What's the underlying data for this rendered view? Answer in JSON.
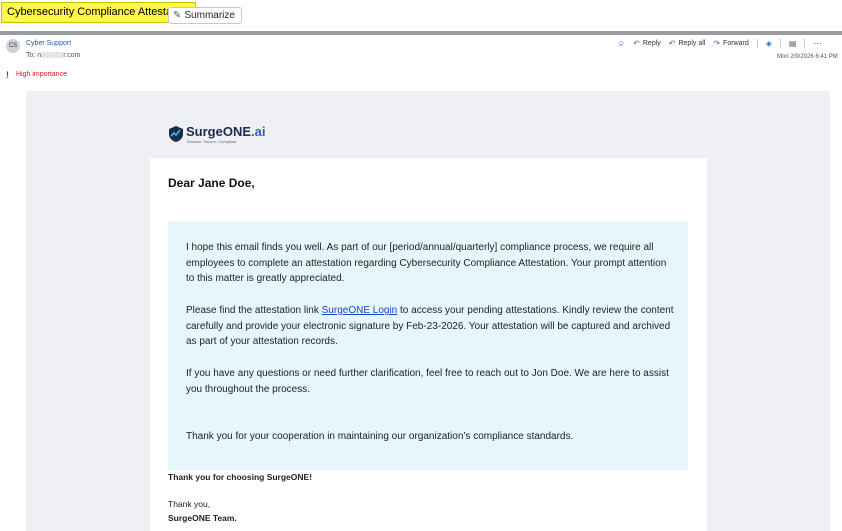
{
  "topbar": {
    "subject": "Cybersecurity Compliance Attestation",
    "summarize_label": "Summarize"
  },
  "header": {
    "avatar_initials": "CS",
    "sender": "Cyber Support",
    "to_prefix": "To: n",
    "to_suffix": "r.com",
    "importance": "High importance",
    "datetime": "Mon 2/9/2026 6:41 PM",
    "actions": {
      "reply": "Reply",
      "reply_all": "Reply all",
      "forward": "Forward"
    }
  },
  "email": {
    "logo_brand_main": "SurgeONE",
    "logo_brand_suffix": ".ai",
    "logo_tagline": "Smarter. Secure. Compliant.",
    "greeting": "Dear Jane Doe,",
    "p1": "I hope this email finds you well. As part of our [period/annual/quarterly] compliance process, we require all employees to complete an attestation regarding Cybersecurity Compliance Attestation. Your prompt attention to this matter is greatly appreciated.",
    "p2_before": "Please find the attestation link ",
    "p2_link": "SurgeONE Login",
    "p2_after": " to access your pending attestations. Kindly review the content carefully and provide your electronic signature by Feb-23-2026. Your attestation will be captured and archived as part of your attestation records.",
    "p3": "If you have any questions or need further clarification, feel free to reach out to Jon Doe. We are here to assist you throughout the process.",
    "p4": "Thank you for your cooperation in maintaining our organization’s compliance standards.",
    "thanks_choose": "Thank you for choosing SurgeONE!",
    "sign_thanks": "Thank you,",
    "sign_team": "SurgeONE Team."
  },
  "colors": {
    "subject_highlight": "#fff84a",
    "link": "#1a44c9",
    "importance": "#c41e1e",
    "message_box": "#e6f7fb"
  }
}
